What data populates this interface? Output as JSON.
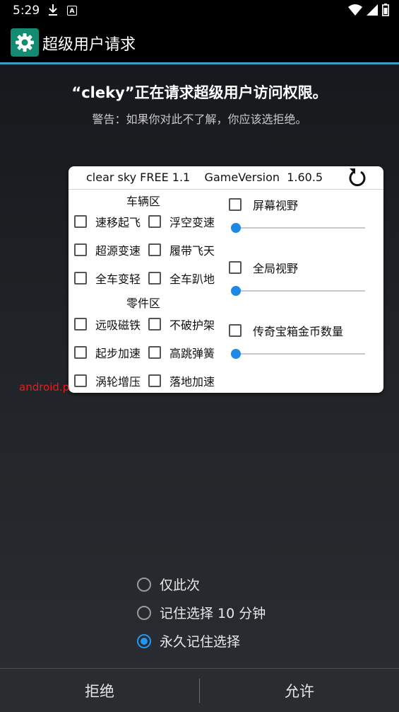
{
  "status_bar": {
    "time": "5:29"
  },
  "app_bar": {
    "title": "超级用户请求"
  },
  "request": {
    "title": "“cleky”正在请求超级用户访问权限。",
    "warning": "警告：如果你对此不了解，你应该选拒绝。"
  },
  "panel": {
    "header": "clear sky FREE 1.1    GameVersion  1.60.5",
    "vehicle_section": "车辆区",
    "parts_section": "零件区",
    "col1": [
      "速移起飞",
      "超源变速",
      "全车变轻",
      "远吸磁铁",
      "起步加速",
      "涡轮增压"
    ],
    "col2": [
      "浮空变速",
      "履带飞天",
      "全车趴地",
      "不破护架",
      "高跳弹簧",
      "落地加速"
    ],
    "right": [
      {
        "label": "屏幕视野",
        "slider_value": 0
      },
      {
        "label": "全局视野",
        "slider_value": 0
      },
      {
        "label": "传奇宝箱金币数量",
        "slider_value": 0
      }
    ]
  },
  "package_text": "android.p",
  "options": [
    {
      "label": "仅此次",
      "selected": false
    },
    {
      "label": "记住选择 10 分钟",
      "selected": false
    },
    {
      "label": "永久记住选择",
      "selected": true
    }
  ],
  "buttons": {
    "deny": "拒绝",
    "allow": "允许"
  },
  "colors": {
    "accent": "#2196f3",
    "app_icon": "#138a72",
    "appbar_line": "#3aa0c8",
    "package_text": "#e02020"
  }
}
